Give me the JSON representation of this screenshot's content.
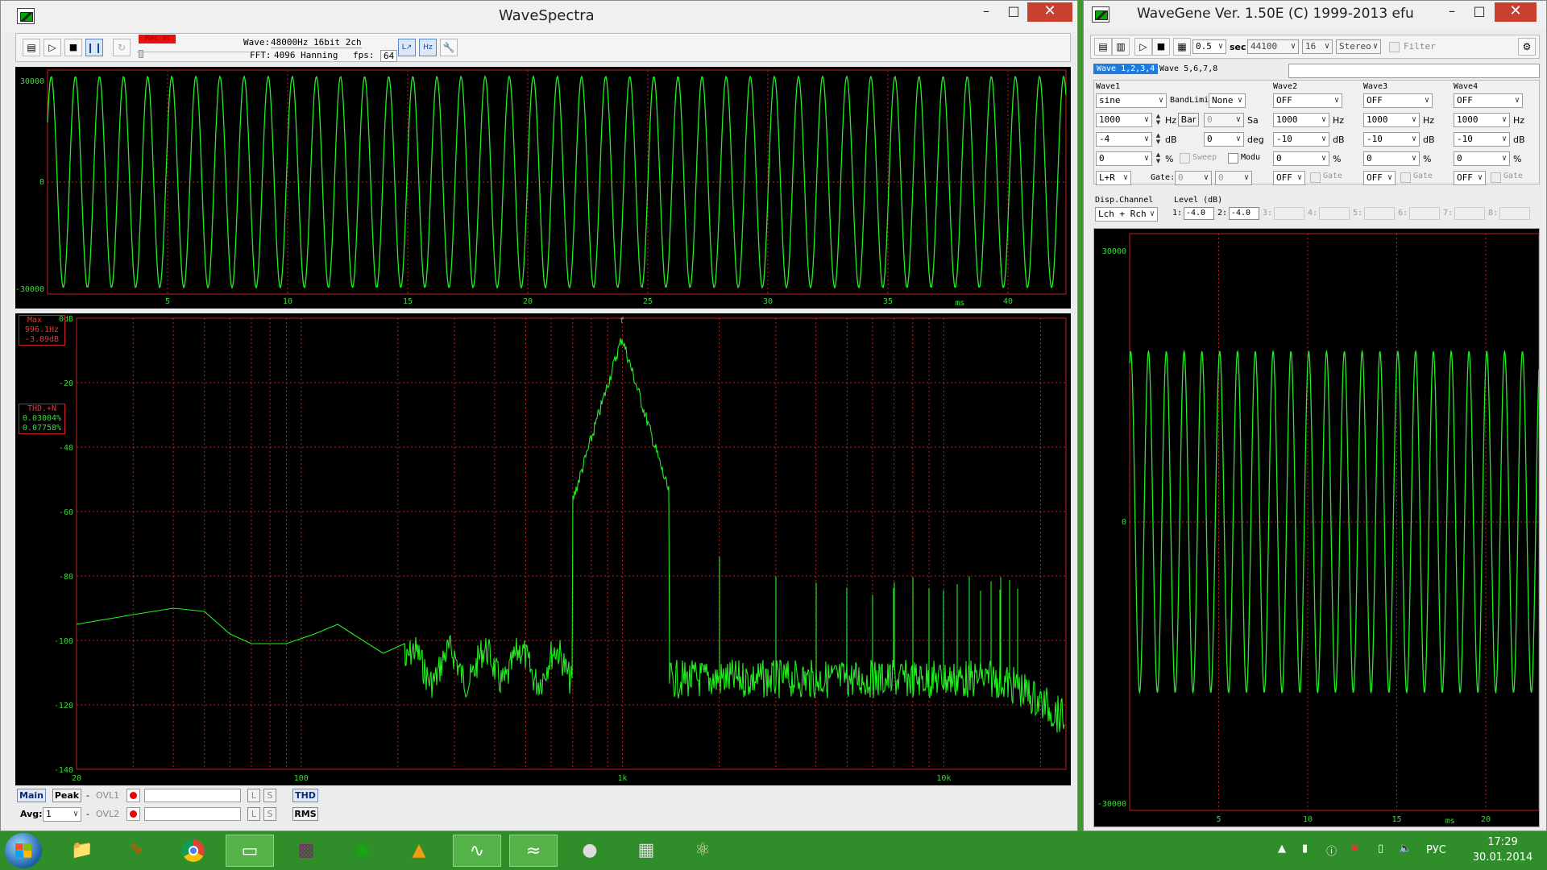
{
  "spectra": {
    "title": "WaveSpectra",
    "rec_in": "Rec. In",
    "wave_info_label": "Wave:",
    "wave_info": "48000Hz 16bit 2ch",
    "fft_label": "FFT:",
    "fft_info": "4096 Hanning",
    "fps_label": "fps:",
    "fps": "64",
    "wave_plot": {
      "y_ticks": [
        "30000",
        "0",
        "-30000"
      ],
      "x_ticks": [
        "5",
        "10",
        "15",
        "20",
        "25",
        "30",
        "35",
        "40"
      ],
      "x_unit": "ms"
    },
    "spec_plot": {
      "y_ticks": [
        "0dB",
        "-20",
        "-40",
        "-60",
        "-80",
        "-100",
        "-120",
        "-140"
      ],
      "x_ticks": [
        "20",
        "100",
        "1k",
        "10k"
      ],
      "max_label": "Max",
      "max_freq": "996.1Hz",
      "max_db": "-3.89dB",
      "thd_label": "THD.+N",
      "thd1": "0.03004%",
      "thd2": "0.07758%",
      "marker": "f"
    },
    "bottom": {
      "main": "Main",
      "peak": "Peak",
      "avg_label": "Avg:",
      "avg_value": "1",
      "ovl1": "OVL1",
      "ovl2": "OVL2",
      "l": "L",
      "s": "S",
      "thd": "THD",
      "rms": "RMS",
      "dash": "-"
    }
  },
  "gene": {
    "title": "WaveGene  Ver. 1.50E  (C) 1999-2013 efu",
    "toolbar": {
      "duration": "0.5",
      "sec": "sec",
      "rate": "44100",
      "bits": "16",
      "channels": "Stereo",
      "filter": "Filter"
    },
    "tabs": [
      "Wave 1,2,3,4",
      "Wave 5,6,7,8"
    ],
    "wave1": {
      "label": "Wave1",
      "type": "sine",
      "bandlimit_label": "BandLimit:",
      "bandlimit": "None",
      "freq": "1000",
      "hz": "Hz",
      "bar": "Bar",
      "sa_value": "0",
      "sa": "Sa",
      "level": "-4",
      "db": "dB",
      "phase": "0",
      "deg": "deg",
      "offset": "0",
      "pct": "%",
      "sweep": "Sweep",
      "modu": "Modu",
      "channel": "L+R",
      "gate_label": "Gate:",
      "gate1": "0",
      "gate2": "0"
    },
    "waves": [
      {
        "label": "Wave2",
        "type": "OFF",
        "freq": "1000",
        "level": "-10",
        "offset": "0",
        "chan": "OFF",
        "gate": "Gate"
      },
      {
        "label": "Wave3",
        "type": "OFF",
        "freq": "1000",
        "level": "-10",
        "offset": "0",
        "chan": "OFF",
        "gate": "Gate"
      },
      {
        "label": "Wave4",
        "type": "OFF",
        "freq": "1000",
        "level": "-10",
        "offset": "0",
        "chan": "OFF",
        "gate": "Gate"
      }
    ],
    "disp_channel_label": "Disp.Channel",
    "disp_channel": "Lch + Rch",
    "level_label": "Level (dB)",
    "levels": [
      {
        "n": "1:",
        "v": "-4.0"
      },
      {
        "n": "2:",
        "v": "-4.0"
      },
      {
        "n": "3:",
        "v": ""
      },
      {
        "n": "4:",
        "v": ""
      },
      {
        "n": "5:",
        "v": ""
      },
      {
        "n": "6:",
        "v": ""
      },
      {
        "n": "7:",
        "v": ""
      },
      {
        "n": "8:",
        "v": ""
      }
    ],
    "plot": {
      "y_ticks": [
        "30000",
        "0",
        "-30000"
      ],
      "x_ticks": [
        "5",
        "10",
        "15",
        "20"
      ],
      "x_unit": "ms"
    }
  },
  "taskbar": {
    "lang": "РУС",
    "time": "17:29",
    "date": "30.01.2014"
  },
  "colors": {
    "trace": "#22ee22",
    "grid": "#c22020",
    "tick": "#33dd33",
    "desktop": "#3c9a2c"
  }
}
